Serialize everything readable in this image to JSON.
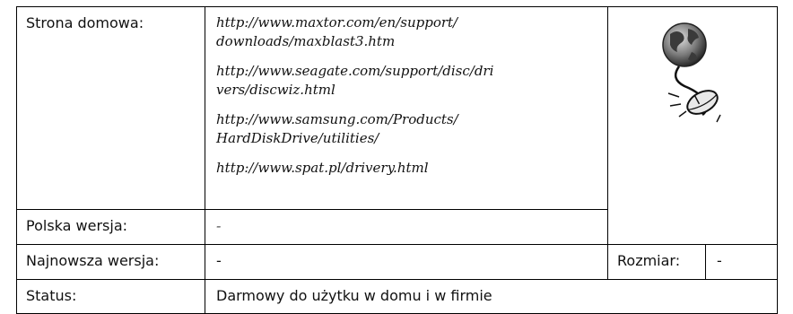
{
  "rows": {
    "homepage": {
      "label": "Strona domowa:",
      "urls": [
        {
          "line1": "http://www.maxtor.com/en/support/",
          "line2": "downloads/maxblast3.htm"
        },
        {
          "line1": "http://www.seagate.com/support/disc/dri",
          "line2": "vers/discwiz.html"
        },
        {
          "line1": "http://www.samsung.com/Products/",
          "line2": "HardDiskDrive/utilities/"
        },
        {
          "line1": "http://www.spat.pl/drivery.html",
          "line2": ""
        }
      ],
      "icon": "globe-mouse-icon"
    },
    "polish": {
      "label": "Polska wersja:",
      "value": "-"
    },
    "latest": {
      "label": "Najnowsza wersja:",
      "value": "-",
      "size_label": "Rozmiar:",
      "size_value": "-"
    },
    "status": {
      "label": "Status:",
      "value": "Darmowy do użytku w domu i w firmie"
    }
  }
}
